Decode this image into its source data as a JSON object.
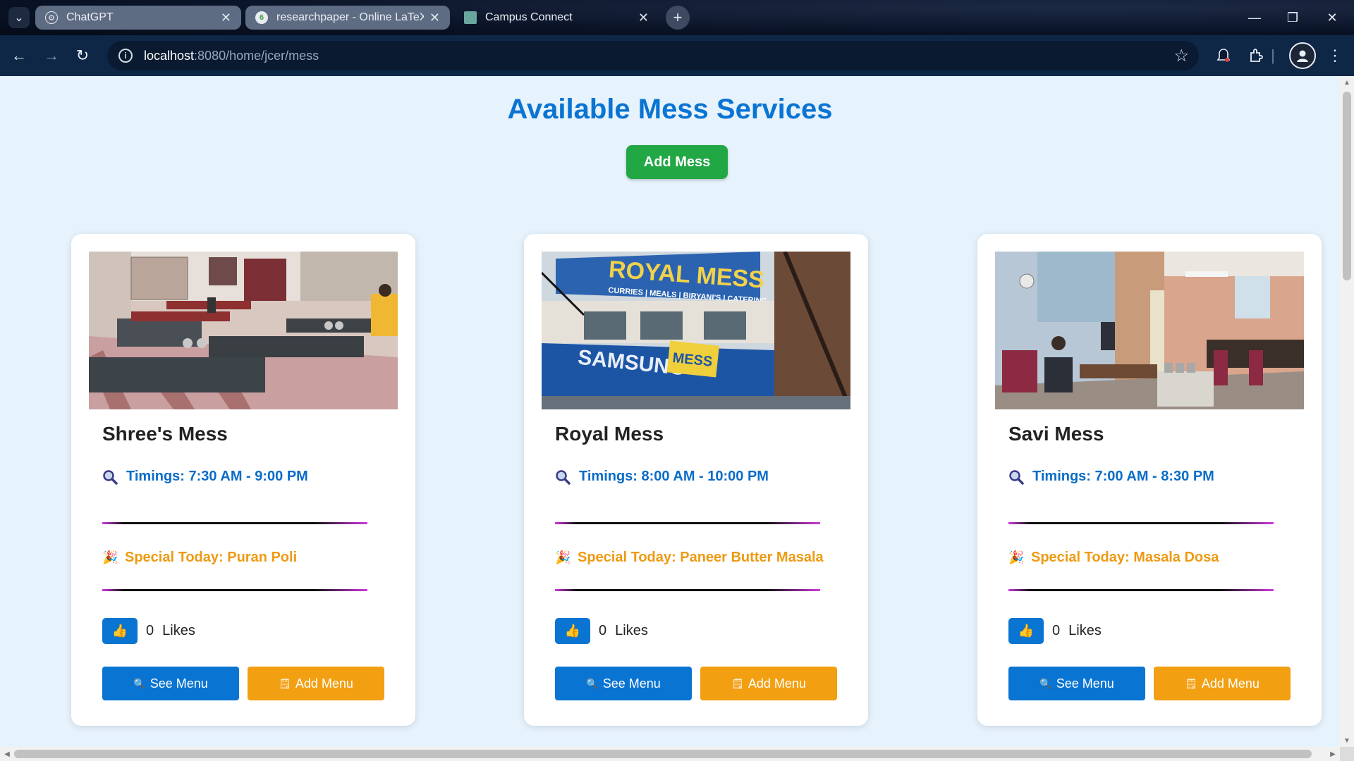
{
  "browser": {
    "tabs": [
      {
        "title": "ChatGPT",
        "icon": "chatgpt-icon"
      },
      {
        "title": "researchpaper - Online LaTeX E",
        "icon": "overleaf-icon"
      },
      {
        "title": "Campus Connect",
        "icon": "campus-connect-icon",
        "active": true
      }
    ],
    "url_host": "localhost",
    "url_rest": ":8080/home/jcer/mess"
  },
  "page": {
    "title": "Available Mess Services",
    "add_mess_label": "Add Mess"
  },
  "messes": [
    {
      "name": "Shree's Mess",
      "timings": "Timings: 7:30 AM - 9:00 PM",
      "special": "Special Today: Puran Poli",
      "likes": "0",
      "likes_label": "Likes",
      "see_menu": "See Menu",
      "add_menu": "Add Menu"
    },
    {
      "name": "Royal Mess",
      "timings": "Timings: 8:00 AM - 10:00 PM",
      "special": "Special Today: Paneer Butter Masala",
      "likes": "0",
      "likes_label": "Likes",
      "see_menu": "See Menu",
      "add_menu": "Add Menu",
      "signboard_text": "ROYAL MESS",
      "signboard_subtext": "CURRIES | MEALS | BIRYANI'S | CATERING"
    },
    {
      "name": "Savi Mess",
      "timings": "Timings: 7:00 AM - 8:30 PM",
      "special": "Special Today: Masala Dosa",
      "likes": "0",
      "likes_label": "Likes",
      "see_menu": "See Menu",
      "add_menu": "Add Menu"
    }
  ],
  "colors": {
    "title_blue": "#0a74d2",
    "add_mess_green": "#22a745",
    "timings_blue": "#0a6cc8",
    "special_orange": "#ee9a12",
    "add_menu_orange": "#f29f12",
    "page_bg": "#e6f2fc"
  }
}
